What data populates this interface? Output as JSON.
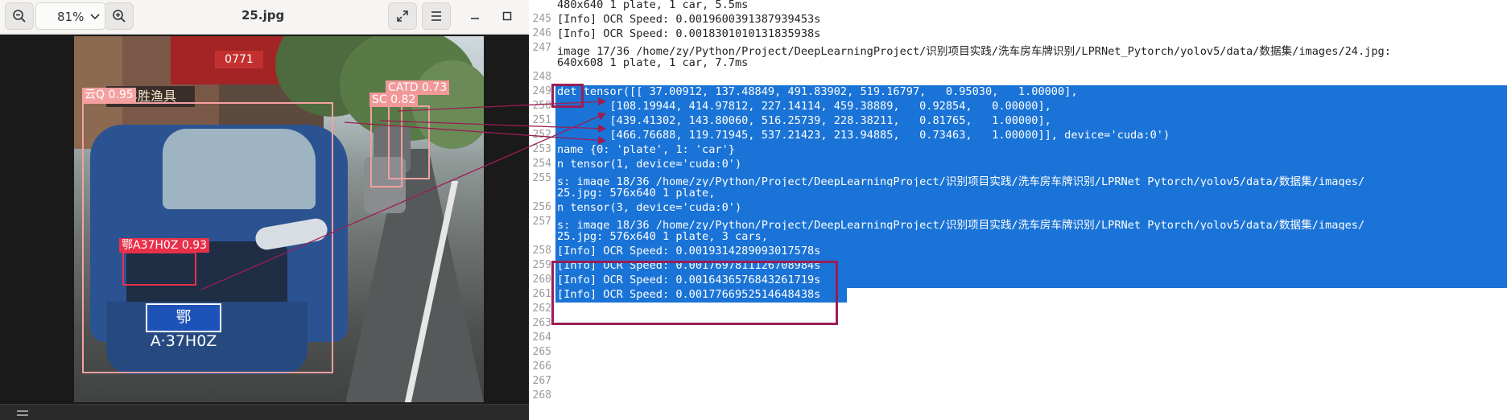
{
  "viewer": {
    "zoom": "81%",
    "title": "25.jpg",
    "icons": {
      "zoom_out": "zoom-out-icon",
      "zoom_in": "zoom-in-icon",
      "fullscreen": "fullscreen-icon",
      "menu": "hamburger-menu-icon",
      "minimize": "minimize-icon",
      "maximize": "maximize-icon"
    },
    "shop_signs": [
      "丰胜渔具",
      "0771"
    ],
    "detections": [
      {
        "label": "云Q 0.95",
        "kind": "car"
      },
      {
        "label": "CATD 0.73",
        "kind": "plate"
      },
      {
        "label": "SC 0.82",
        "kind": "car"
      },
      {
        "label": "鄂A37H0Z 0.93",
        "kind": "plate"
      }
    ],
    "plate_text": "鄂A·37H0Z",
    "colors": {
      "car_box": "#f5a0a0",
      "plate_box": "#e8304a",
      "annotation": "#9a1e55"
    }
  },
  "log": {
    "lines": [
      {
        "n": "",
        "text": "480x640 1 plate, 1 car, 5.5ms"
      },
      {
        "n": "245",
        "text": "[Info] OCR Speed: 0.0019600391387939453s"
      },
      {
        "n": "246",
        "text": "[Info] OCR Speed: 0.0018301010131835938s"
      },
      {
        "n": "247",
        "text": "image 17/36 /home/zy/Python/Project/DeepLearningProject/识别项目实践/洗车房车牌识别/LPRNet_Pytorch/yolov5/data/数据集/images/24.jpg:"
      },
      {
        "n": "",
        "text": "640x608 1 plate, 1 car, 7.7ms"
      },
      {
        "n": "248",
        "text": ""
      },
      {
        "n": "249",
        "text": "det tensor([[ 37.00912, 137.48849, 491.83902, 519.16797,   0.95030,   1.00000],"
      },
      {
        "n": "250",
        "text": "        [108.19944, 414.97812, 227.14114, 459.38889,   0.92854,   0.00000],"
      },
      {
        "n": "251",
        "text": "        [439.41302, 143.80060, 516.25739, 228.38211,   0.81765,   1.00000],"
      },
      {
        "n": "252",
        "text": "        [466.76688, 119.71945, 537.21423, 213.94885,   0.73463,   1.00000]], device='cuda:0')"
      },
      {
        "n": "253",
        "text": "name {0: 'plate', 1: 'car'}"
      },
      {
        "n": "254",
        "text": "n tensor(1, device='cuda:0')"
      },
      {
        "n": "255",
        "text": "s: image 18/36 /home/zy/Python/Project/DeepLearningProject/识别项目实践/洗车房车牌识别/LPRNet_Pytorch/yolov5/data/数据集/images/"
      },
      {
        "n": "",
        "text": "25.jpg: 576x640 1 plate,"
      },
      {
        "n": "256",
        "text": "n tensor(3, device='cuda:0')"
      },
      {
        "n": "257",
        "text": "s: image 18/36 /home/zy/Python/Project/DeepLearningProject/识别项目实践/洗车房车牌识别/LPRNet_Pytorch/yolov5/data/数据集/images/"
      },
      {
        "n": "",
        "text": "25.jpg: 576x640 1 plate, 3 cars,"
      },
      {
        "n": "258",
        "text": "[Info] OCR Speed: 0.0019314289093017578s"
      },
      {
        "n": "259",
        "text": "[Info] OCR Speed: 0.0017697811126708984s"
      },
      {
        "n": "260",
        "text": "[Info] OCR Speed: 0.0016436576843261719s"
      },
      {
        "n": "261",
        "text": "[Info] OCR Speed: 0.0017766952514648438s"
      },
      {
        "n": "262",
        "text": ""
      },
      {
        "n": "263",
        "text": ""
      },
      {
        "n": "264",
        "text": ""
      },
      {
        "n": "265",
        "text": ""
      },
      {
        "n": "266",
        "text": ""
      },
      {
        "n": "267",
        "text": ""
      },
      {
        "n": "268",
        "text": ""
      }
    ],
    "selection_color": "#1a73d6"
  }
}
